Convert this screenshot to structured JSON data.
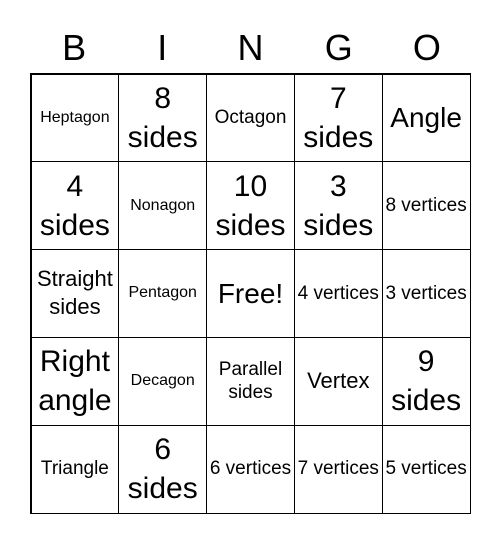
{
  "header": [
    "B",
    "I",
    "N",
    "G",
    "O"
  ],
  "cells": [
    "Heptagon",
    "8 sides",
    "Octagon",
    "7 sides",
    "Angle",
    "4 sides",
    "Nonagon",
    "10 sides",
    "3 sides",
    "8 vertices",
    "Straight sides",
    "Pentagon",
    "Free!",
    "4 vertices",
    "3 vertices",
    "Right angle",
    "Decagon",
    "Parallel sides",
    "Vertex",
    "9 sides",
    "Triangle",
    "6 sides",
    "6 vertices",
    "7 vertices",
    "5 vertices"
  ]
}
